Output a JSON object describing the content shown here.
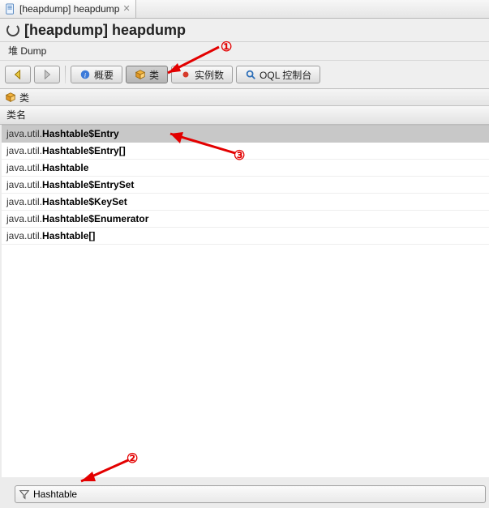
{
  "tab": {
    "label": "[heapdump] heapdump"
  },
  "heading": "[heapdump] heapdump",
  "subtitle": "堆 Dump",
  "toolbar": {
    "overview": "概要",
    "classes": "类",
    "instances": "实例数",
    "oql": "OQL 控制台"
  },
  "panel": {
    "title": "类"
  },
  "columns": {
    "class_name": "类名"
  },
  "classes": [
    {
      "prefix": "java.util.",
      "name": "Hashtable$Entry",
      "selected": true
    },
    {
      "prefix": "java.util.",
      "name": "Hashtable$Entry[]",
      "selected": false
    },
    {
      "prefix": "java.util.",
      "name": "Hashtable",
      "selected": false
    },
    {
      "prefix": "java.util.",
      "name": "Hashtable$EntrySet",
      "selected": false
    },
    {
      "prefix": "java.util.",
      "name": "Hashtable$KeySet",
      "selected": false
    },
    {
      "prefix": "java.util.",
      "name": "Hashtable$Enumerator",
      "selected": false
    },
    {
      "prefix": "java.util.",
      "name": "Hashtable[]",
      "selected": false
    }
  ],
  "filter": {
    "value": "Hashtable"
  },
  "callouts": {
    "one": "①",
    "two": "②",
    "three": "③"
  }
}
